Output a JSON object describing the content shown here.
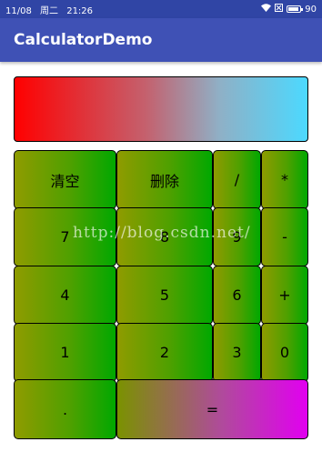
{
  "status_bar": {
    "date": "11/08",
    "weekday": "周二",
    "time": "21:26",
    "battery": "90",
    "battery_level_percent": 90,
    "icons": [
      "wifi-icon",
      "sim-icon",
      "battery-icon"
    ]
  },
  "app_bar": {
    "title": "CalculatorDemo"
  },
  "display": {
    "text": ""
  },
  "keys": {
    "clear": "清空",
    "delete": "删除",
    "divide": "/",
    "multiply": "*",
    "seven": "7",
    "eight": "8",
    "nine": "9",
    "minus": "-",
    "four": "4",
    "five": "5",
    "six": "6",
    "plus": "+",
    "one": "1",
    "two": "2",
    "three": "3",
    "zero": "0",
    "dot": ".",
    "equals": "="
  },
  "watermark": "http://blog.csdn.net/",
  "colors": {
    "status_bar": "#3045a5",
    "app_bar": "#3f51b5",
    "key_gradient_start": "#8f9b00",
    "key_gradient_end": "#00a800",
    "equals_gradient_end": "#e100f0",
    "display_gradient_start": "#ff0000",
    "display_gradient_end": "#4cd9ff"
  }
}
